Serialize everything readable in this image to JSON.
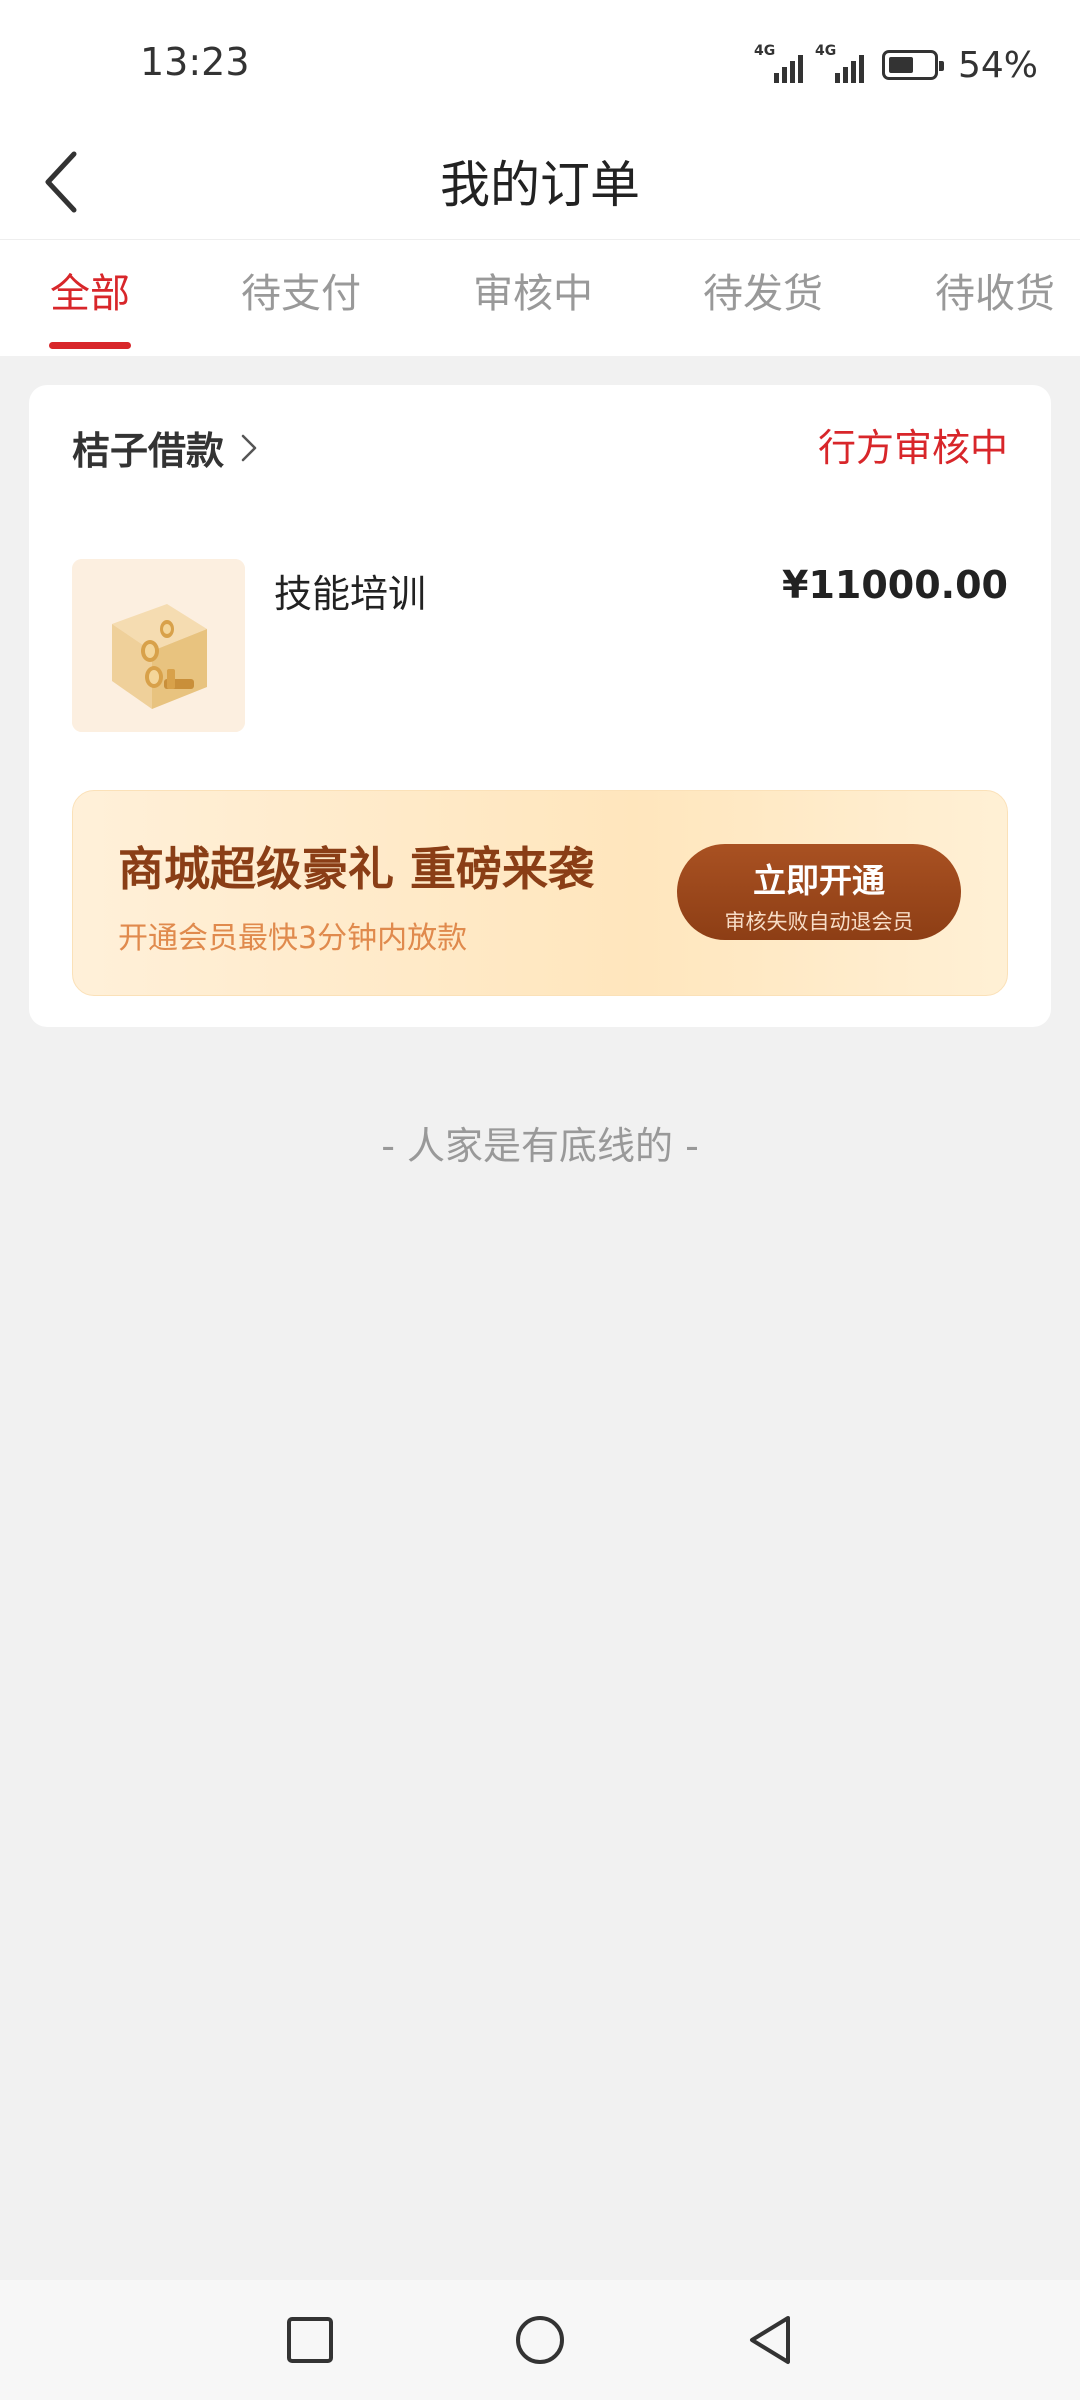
{
  "status_bar": {
    "time": "13:23",
    "network_1": "4G",
    "network_2": "4G",
    "battery_level": 0.54,
    "battery_pct": "54%"
  },
  "header": {
    "title": "我的订单",
    "back_icon": "chevron-left-icon"
  },
  "tabs": [
    {
      "label": "全部",
      "active": true
    },
    {
      "label": "待支付",
      "active": false
    },
    {
      "label": "审核中",
      "active": false
    },
    {
      "label": "待发货",
      "active": false
    },
    {
      "label": "待收货",
      "active": false
    }
  ],
  "order": {
    "merchant": "桔子借款",
    "status": "行方审核中",
    "product_name": "技能培训",
    "price": "¥11000.00",
    "thumbnail_icon": "coin-box-icon"
  },
  "promo": {
    "title": "商城超级豪礼 重磅来袭",
    "subtitle": "开通会员最快3分钟内放款",
    "button_label": "立即开通",
    "button_sub": "审核失败自动退会员"
  },
  "footer_text": "- 人家是有底线的 -",
  "navbar": {
    "recent_icon": "square-icon",
    "home_icon": "circle-icon",
    "back_icon": "triangle-back-icon"
  },
  "colors": {
    "accent": "#d8262a",
    "promo_button": "#964619",
    "background": "#f1f1f1"
  }
}
